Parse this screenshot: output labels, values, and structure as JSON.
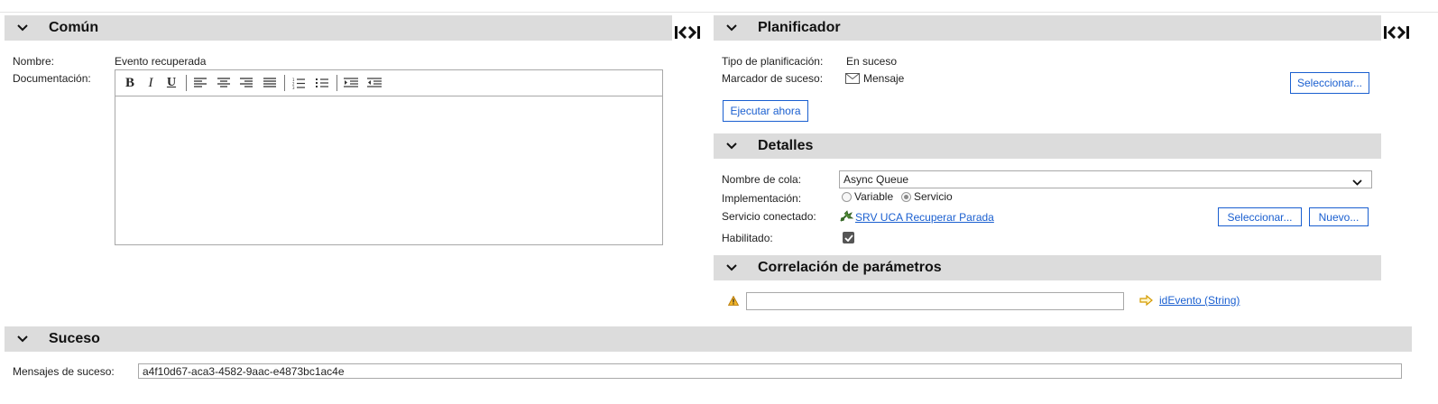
{
  "comun": {
    "title": "Común",
    "nombre_label": "Nombre:",
    "nombre_value": "Evento recuperada",
    "documentacion_label": "Documentación:"
  },
  "planificador": {
    "title": "Planificador",
    "tipo_label": "Tipo de planificación:",
    "tipo_value": "En suceso",
    "marcador_label": "Marcador de suceso:",
    "marcador_value": "Mensaje",
    "seleccionar_label": "Seleccionar...",
    "ejecutar_label": "Ejecutar ahora"
  },
  "detalles": {
    "title": "Detalles",
    "cola_label": "Nombre de cola:",
    "cola_value": "Async Queue",
    "impl_label": "Implementación:",
    "impl_options": [
      "Variable",
      "Servicio"
    ],
    "impl_selected": "Servicio",
    "servicio_label": "Servicio conectado:",
    "servicio_value": "SRV UCA Recuperar Parada",
    "seleccionar_label": "Seleccionar...",
    "nuevo_label": "Nuevo...",
    "habilitado_label": "Habilitado:",
    "habilitado_checked": true
  },
  "correlacion": {
    "title": "Correlación de parámetros",
    "input_value": "",
    "param_link": "idEvento (String)"
  },
  "suceso": {
    "title": "Suceso",
    "mensajes_label": "Mensajes de suceso:",
    "mensajes_value": "a4f10d67-aca3-4582-9aac-e4873bc1ac4e"
  },
  "icons": {
    "collapse": "chevron-down-icon",
    "expand_toggle": "expand-collapse-icon",
    "warning": "warning-icon",
    "arrow": "arrow-right-icon",
    "envelope": "envelope-icon",
    "service": "service-icon"
  },
  "colors": {
    "section_bg": "#dcdcdc",
    "link": "#1a5fd0",
    "warning": "#e8a317"
  }
}
